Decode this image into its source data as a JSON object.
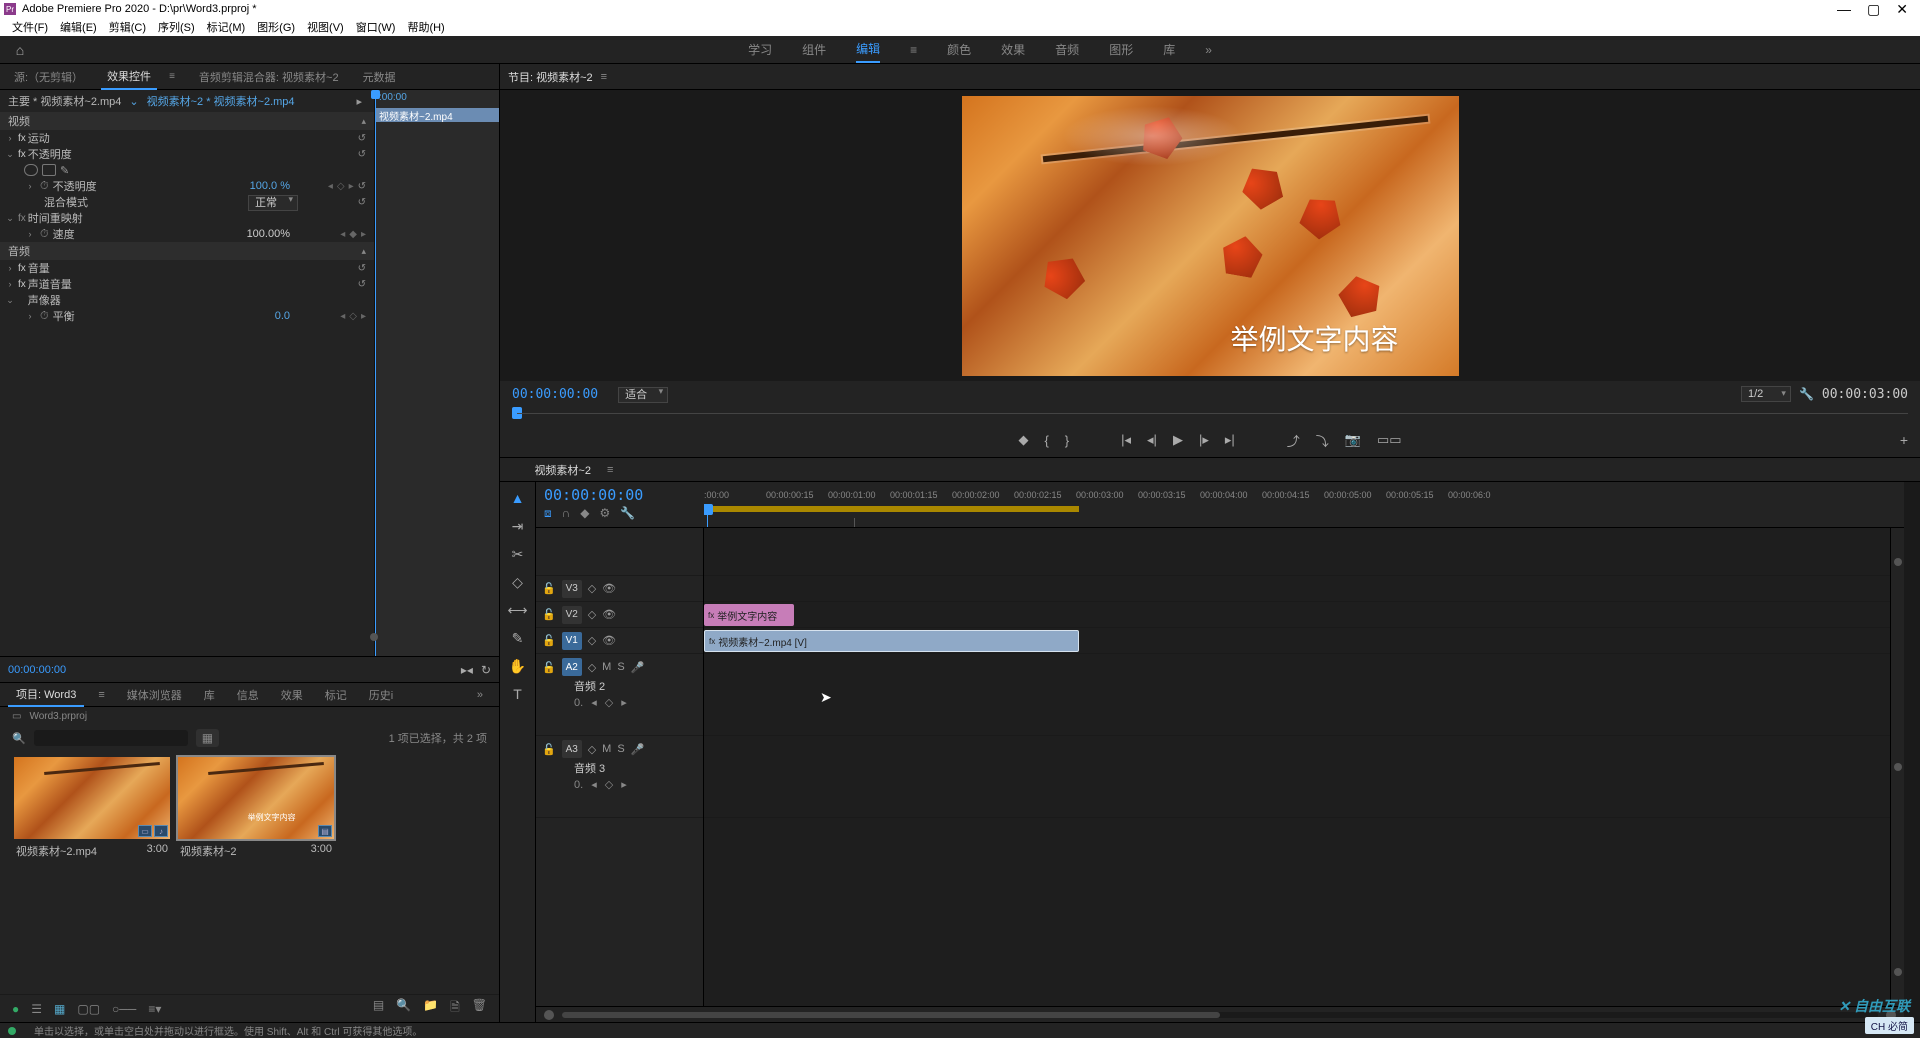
{
  "app": {
    "title": "Adobe Premiere Pro 2020 - D:\\pr\\Word3.prproj *",
    "icon_label": "Pr"
  },
  "menubar": [
    "文件(F)",
    "编辑(E)",
    "剪辑(C)",
    "序列(S)",
    "标记(M)",
    "图形(G)",
    "视图(V)",
    "窗口(W)",
    "帮助(H)"
  ],
  "workspaces": [
    "学习",
    "组件",
    "编辑",
    "颜色",
    "效果",
    "音频",
    "图形",
    "库"
  ],
  "source_tabs": {
    "source": "源:（无剪辑）",
    "effect_controls": "效果控件",
    "audio_mixer": "音频剪辑混合器: 视频素材~2",
    "metadata": "元数据"
  },
  "ec": {
    "master": "主要 * 视频素材~2.mp4",
    "seq": "视频素材~2 * 视频素材~2.mp4",
    "time_head": ":00:00",
    "clip": "视频素材~2.mp4",
    "video_h": "视频",
    "motion": "运动",
    "opacity": "不透明度",
    "opacity_val": "100.0 %",
    "blend": "混合模式",
    "blend_val": "正常",
    "remap": "时间重映射",
    "speed": "速度",
    "speed_val": "100.00%",
    "audio_h": "音频",
    "volume": "音量",
    "chan_vol": "声道音量",
    "panner": "声像器",
    "balance": "平衡",
    "balance_val": "0.0",
    "time": "00:00:00:00"
  },
  "project": {
    "tabs": {
      "project": "项目: Word3",
      "browser": "媒体浏览器",
      "lib": "库",
      "info": "信息",
      "effects": "效果",
      "markers": "标记",
      "history": "历史i"
    },
    "bin": "Word3.prproj",
    "search_ph": "",
    "status": "1 项已选择，共 2 项",
    "items": [
      {
        "name": "视频素材~2.mp4",
        "dur": "3:00"
      },
      {
        "name": "视频素材~2",
        "dur": "3:00"
      }
    ]
  },
  "program": {
    "title": "节目: 视频素材~2",
    "overlay_text": "举例文字内容",
    "time": "00:00:00:00",
    "fit": "适合",
    "res": "1/2",
    "dur": "00:00:03:00"
  },
  "timeline": {
    "tab": "视频素材~2",
    "time": "00:00:00:00",
    "marks": [
      ":00:00",
      "00:00:00:15",
      "00:00:01:00",
      "00:00:01:15",
      "00:00:02:00",
      "00:00:02:15",
      "00:00:03:00",
      "00:00:03:15",
      "00:00:04:00",
      "00:00:04:15",
      "00:00:05:00",
      "00:00:05:15",
      "00:00:06:0"
    ],
    "tracks": {
      "v3": "V3",
      "v2": "V2",
      "v1": "V1",
      "a2": "A2",
      "a3": "A3",
      "a2_name": "音频 2",
      "a3_name": "音频 3",
      "a_zero": "0."
    },
    "clips": {
      "text": "举例文字内容",
      "video": "视频素材~2.mp4 [V]"
    }
  },
  "status": "单击以选择，或单击空白处并拖动以进行框选。使用 Shift、Alt 和 Ctrl 可获得其他选项。",
  "watermark": "自由互联",
  "ime": "CH 必简"
}
